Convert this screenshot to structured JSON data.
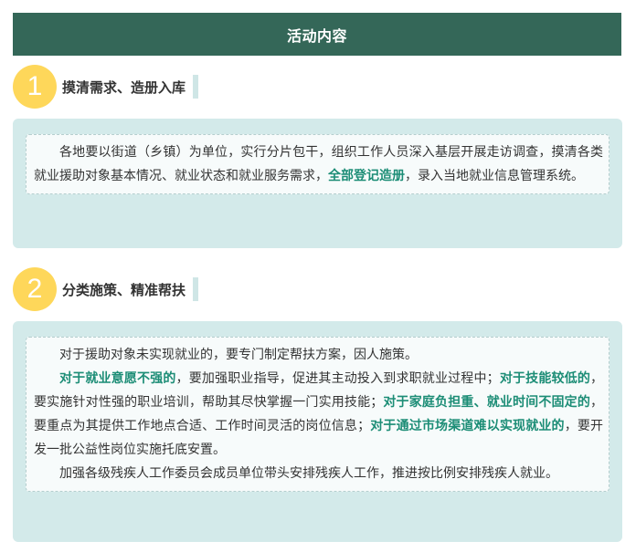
{
  "header": {
    "title": "活动内容"
  },
  "section1": {
    "number": "1",
    "title": "摸清需求、造册入库",
    "para": {
      "t1": "各地要以街道（乡镇）为单位，实行分片包干，组织工作人员深入基层开展走访调查，摸清各类就业援助对象基本情况、就业状态和就业服务需求，",
      "h1": "全部登记造册",
      "t2": "，录入当地就业信息管理系统。"
    }
  },
  "section2": {
    "number": "2",
    "title": "分类施策、精准帮扶",
    "p1": "对于援助对象未实现就业的，要专门制定帮扶方案，因人施策。",
    "p2": {
      "h1": "对于就业意愿不强的",
      "t1": "，要加强职业指导，促进其主动投入到求职就业过程中；",
      "h2": "对于技能较低的",
      "t2": "，要实施针对性强的职业培训，帮助其尽快掌握一门实用技能；",
      "h3": "对于家庭负担重、就业时间不固定的",
      "t3": "，要重点为其提供工作地点合适、工作时间灵活的岗位信息；",
      "h4": "对于通过市场渠道难以实现就业的",
      "t4": "，要开发一批公益性岗位实施托底安置。"
    },
    "p3": "加强各级残疾人工作委员会成员单位带头安排残疾人工作，推进按比例安排残疾人就业。"
  },
  "colors": {
    "header_bg": "#346758",
    "circle": "#fed75a",
    "box_bg": "#d3eaea",
    "highlight": "#1c8d76"
  }
}
